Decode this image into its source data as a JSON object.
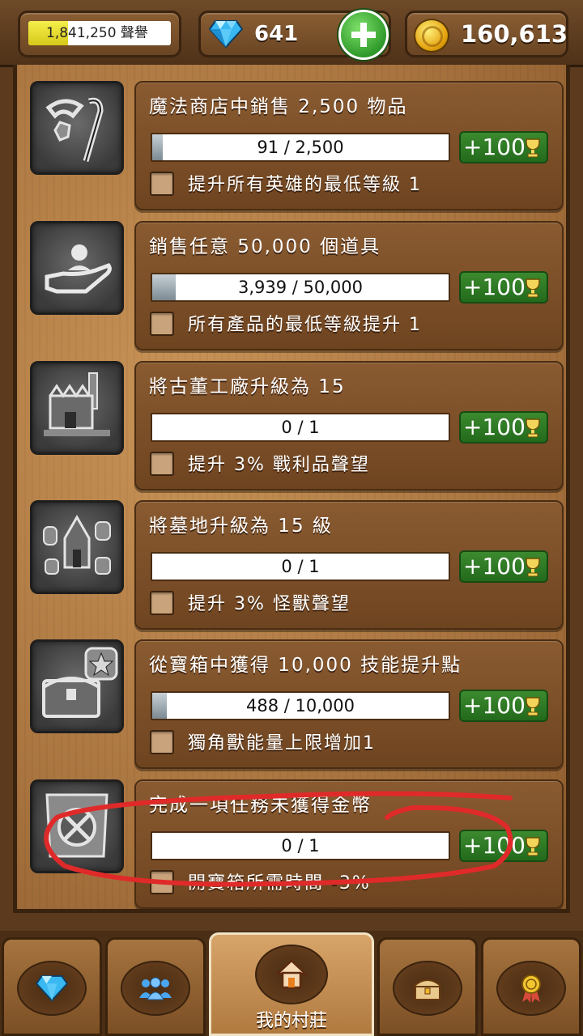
{
  "header": {
    "reputation_text": "1,841,250 聲譽",
    "reputation_progress": 0.28,
    "gems": "641",
    "gold": "160,613"
  },
  "quests": [
    {
      "title": "魔法商店中銷售 2,500 物品",
      "progress_text": "91 / 2,500",
      "progress": 0.036,
      "reward": "+100",
      "bonus": "提升所有英雄的最低等級 1",
      "icon": "magic-items-icon"
    },
    {
      "title": "銷售任意 50,000 個道具",
      "progress_text": "3,939 / 50,000",
      "progress": 0.079,
      "reward": "+100",
      "bonus": "所有產品的最低等級提升 1",
      "icon": "hand-sell-icon"
    },
    {
      "title": "將古董工廠升級為 15",
      "progress_text": "0 / 1",
      "progress": 0,
      "reward": "+100",
      "bonus": "提升 3% 戰利品聲望",
      "icon": "factory-icon"
    },
    {
      "title": "將墓地升級為 15 級",
      "progress_text": "0 / 1",
      "progress": 0,
      "reward": "+100",
      "bonus": "提升 3% 怪獸聲望",
      "icon": "graveyard-icon"
    },
    {
      "title": "從寶箱中獲得 10,000 技能提升點",
      "progress_text": "488 / 10,000",
      "progress": 0.049,
      "reward": "+100",
      "bonus": "獨角獸能量上限增加1",
      "icon": "chest-star-icon"
    },
    {
      "title": "完成一項任務未獲得金幣",
      "progress_text": "0 / 1",
      "progress": 0,
      "reward": "+100",
      "bonus": "開寶箱所需時間 -3%",
      "icon": "no-coin-icon"
    }
  ],
  "nav": {
    "active_label": "我的村莊"
  },
  "colors": {
    "reward_green": "#2e7a25",
    "annotation_red": "#e02a2a"
  }
}
